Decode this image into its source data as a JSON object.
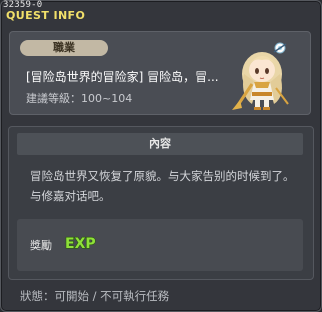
{
  "window": {
    "quest_id": "32359-0",
    "title": "QUEST INFO"
  },
  "header": {
    "category": "職業",
    "quest_name": "[冒险岛世界的冒险家] 冒险岛，冒...",
    "level_text": "建議等級：100~104"
  },
  "content": {
    "section_title": "內容",
    "description": "冒险岛世界又恢复了原貌。与大家告别的时候到了。与修嘉对话吧。",
    "reward_label": "獎勵",
    "reward_icon": "exp-icon",
    "reward_icon_text": "EXP"
  },
  "status": {
    "text": "狀態：可開始 / 不可執行任務"
  },
  "colors": {
    "title": "#f1e06a",
    "badge_bg": "#c2b8a4",
    "exp_green": "#8fe03a",
    "exp_outline": "#2c5a10"
  }
}
